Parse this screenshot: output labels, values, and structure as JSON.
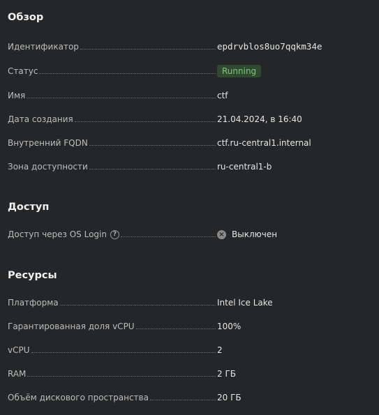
{
  "overview": {
    "title": "Обзор",
    "rows": [
      {
        "label": "Идентификатор",
        "value": "epdrvblos8uo7qqkm34e"
      },
      {
        "label": "Статус",
        "value": "Running"
      },
      {
        "label": "Имя",
        "value": "ctf"
      },
      {
        "label": "Дата создания",
        "value": "21.04.2024, в 16:40"
      },
      {
        "label": "Внутренний FQDN",
        "value": "ctf.ru-central1.internal"
      },
      {
        "label": "Зона доступности",
        "value": "ru-central1-b"
      }
    ]
  },
  "access": {
    "title": "Доступ",
    "rows": [
      {
        "label": "Доступ через OS Login",
        "value": "Выключен",
        "help_icon": "?",
        "status_icon": "×"
      }
    ]
  },
  "resources": {
    "title": "Ресурсы",
    "rows": [
      {
        "label": "Платформа",
        "value": "Intel Ice Lake"
      },
      {
        "label": "Гарантированная доля vCPU",
        "value": "100%"
      },
      {
        "label": "vCPU",
        "value": "2"
      },
      {
        "label": "RAM",
        "value": "2 ГБ"
      },
      {
        "label": "Объём дискового пространства",
        "value": "20 ГБ"
      }
    ]
  },
  "colors": {
    "background": "#242628",
    "status_running_bg": "#2f4a2f",
    "status_running_text": "#7ec57e"
  }
}
